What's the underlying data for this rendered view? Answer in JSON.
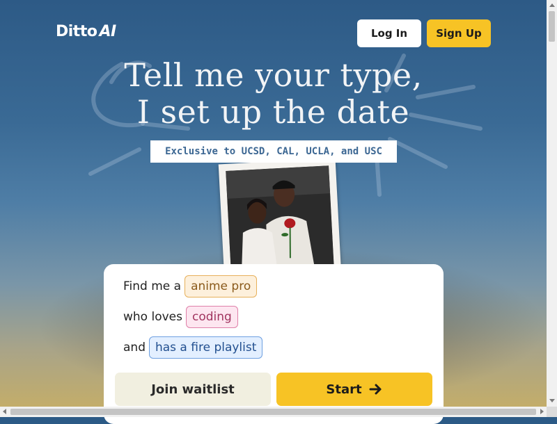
{
  "header": {
    "logo_text": "Ditto",
    "logo_accent": "AI",
    "login_label": "Log In",
    "signup_label": "Sign Up"
  },
  "hero": {
    "headline_line1": "Tell me your type,",
    "headline_line2": "I set up the date",
    "badge": "Exclusive to UCSD, CAL, UCLA, and USC"
  },
  "prompt": {
    "line1_prefix": "Find me a",
    "line1_chip": "anime pro",
    "line2_prefix": "who loves",
    "line2_chip": "coding",
    "line3_prefix": "and",
    "line3_chip": "has a fire playlist"
  },
  "actions": {
    "waitlist_label": "Join waitlist",
    "start_label": "Start"
  },
  "icons": {
    "start_arrow": "arrow-right-icon"
  },
  "colors": {
    "accent_yellow": "#f7c325",
    "background_blue": "#2c5a86",
    "badge_text": "#3c6793"
  }
}
